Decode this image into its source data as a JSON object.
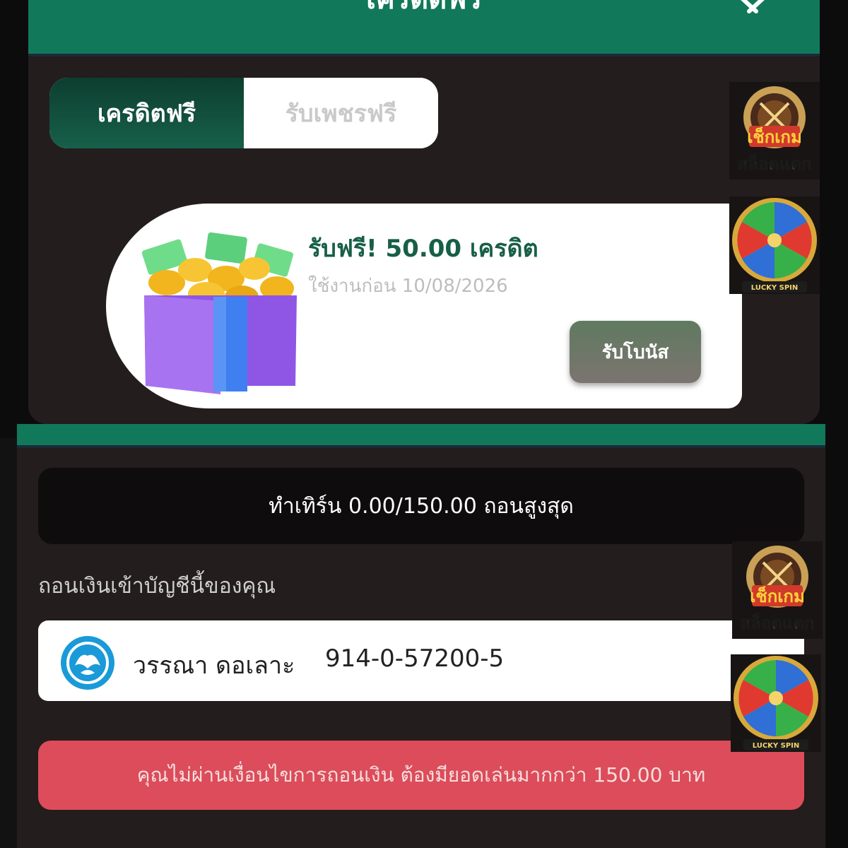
{
  "top_modal": {
    "title": "เครดิตฟรี",
    "tabs": [
      {
        "label": "เครดิตฟรี",
        "active": true
      },
      {
        "label": "รับเพชรฟรี",
        "active": false
      }
    ],
    "promo": {
      "title": "รับฟรี! 50.00 เครดิต",
      "expiry": "ใช้งานก่อน 10/08/2026",
      "claim_label": "รับโบนัส"
    }
  },
  "bottom_modal": {
    "turnover": "ทำเทิร์น 0.00/150.00 ถอนสูงสุด",
    "withdraw_label": "ถอนเงินเข้าบัญชีนี้ของคุณ",
    "account": {
      "name": "วรรณา ดอเลาะ",
      "number": "914-0-57200-5"
    },
    "error": "คุณไม่ผ่านเงื่อนไขการถอนเงิน ต้องมียอดเล่นมากกว่า 150.00 บาท"
  },
  "badges": {
    "slot_caption_top": "เช็กเกม",
    "slot_caption_bottom": "สล็อตแตก",
    "spin_caption": "LUCKY SPIN"
  },
  "colors": {
    "header_green": "#12785a",
    "panel_bg": "#231d1d",
    "promo_title": "#175f47",
    "error_bg": "#dc4c5a",
    "bank_blue": "#1a9ad8"
  },
  "icons": [
    "close-icon",
    "gift-box-icon",
    "bank-logo-icon",
    "slot-machine-badge-icon",
    "lucky-spin-wheel-icon"
  ]
}
